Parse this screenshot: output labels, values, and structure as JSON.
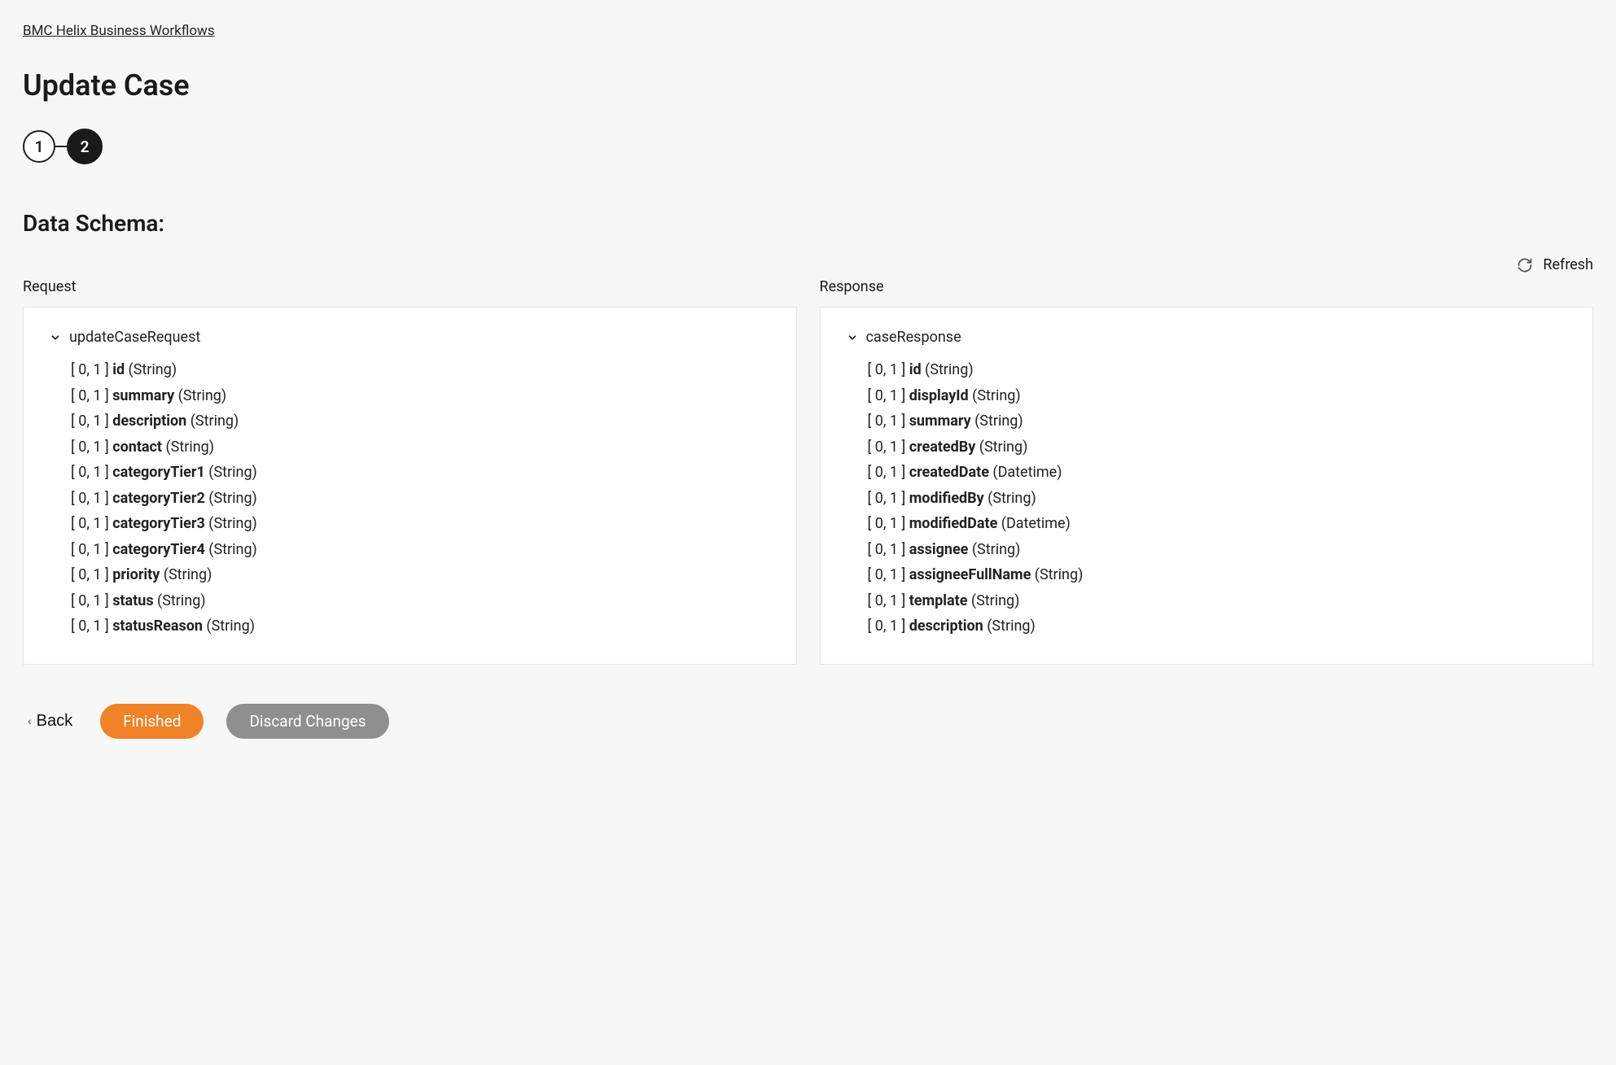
{
  "breadcrumb": {
    "label": "BMC Helix Business Workflows"
  },
  "page": {
    "title": "Update Case"
  },
  "stepper": {
    "steps": [
      "1",
      "2"
    ],
    "activeIndex": 1
  },
  "section": {
    "title": "Data Schema:"
  },
  "refresh": {
    "label": "Refresh"
  },
  "columns": {
    "request": {
      "heading": "Request",
      "root": "updateCaseRequest",
      "fields": [
        {
          "cardinality": "[ 0, 1 ]",
          "name": "id",
          "type": "(String)"
        },
        {
          "cardinality": "[ 0, 1 ]",
          "name": "summary",
          "type": "(String)"
        },
        {
          "cardinality": "[ 0, 1 ]",
          "name": "description",
          "type": "(String)"
        },
        {
          "cardinality": "[ 0, 1 ]",
          "name": "contact",
          "type": "(String)"
        },
        {
          "cardinality": "[ 0, 1 ]",
          "name": "categoryTier1",
          "type": "(String)"
        },
        {
          "cardinality": "[ 0, 1 ]",
          "name": "categoryTier2",
          "type": "(String)"
        },
        {
          "cardinality": "[ 0, 1 ]",
          "name": "categoryTier3",
          "type": "(String)"
        },
        {
          "cardinality": "[ 0, 1 ]",
          "name": "categoryTier4",
          "type": "(String)"
        },
        {
          "cardinality": "[ 0, 1 ]",
          "name": "priority",
          "type": "(String)"
        },
        {
          "cardinality": "[ 0, 1 ]",
          "name": "status",
          "type": "(String)"
        },
        {
          "cardinality": "[ 0, 1 ]",
          "name": "statusReason",
          "type": "(String)"
        }
      ]
    },
    "response": {
      "heading": "Response",
      "root": "caseResponse",
      "fields": [
        {
          "cardinality": "[ 0, 1 ]",
          "name": "id",
          "type": "(String)"
        },
        {
          "cardinality": "[ 0, 1 ]",
          "name": "displayId",
          "type": "(String)"
        },
        {
          "cardinality": "[ 0, 1 ]",
          "name": "summary",
          "type": "(String)"
        },
        {
          "cardinality": "[ 0, 1 ]",
          "name": "createdBy",
          "type": "(String)"
        },
        {
          "cardinality": "[ 0, 1 ]",
          "name": "createdDate",
          "type": "(Datetime)"
        },
        {
          "cardinality": "[ 0, 1 ]",
          "name": "modifiedBy",
          "type": "(String)"
        },
        {
          "cardinality": "[ 0, 1 ]",
          "name": "modifiedDate",
          "type": "(Datetime)"
        },
        {
          "cardinality": "[ 0, 1 ]",
          "name": "assignee",
          "type": "(String)"
        },
        {
          "cardinality": "[ 0, 1 ]",
          "name": "assigneeFullName",
          "type": "(String)"
        },
        {
          "cardinality": "[ 0, 1 ]",
          "name": "template",
          "type": "(String)"
        },
        {
          "cardinality": "[ 0, 1 ]",
          "name": "description",
          "type": "(String)"
        }
      ]
    }
  },
  "footer": {
    "back": "Back",
    "finished": "Finished",
    "discard": "Discard Changes"
  }
}
